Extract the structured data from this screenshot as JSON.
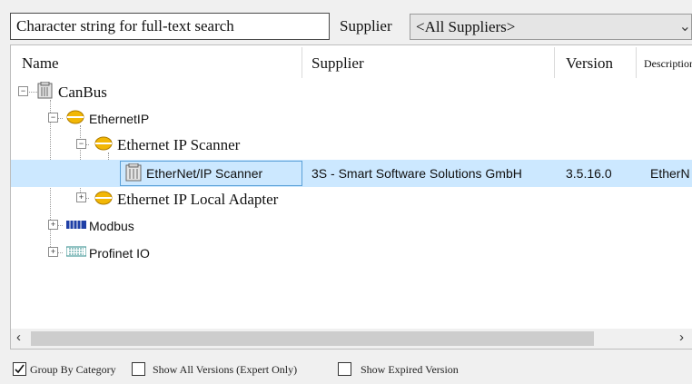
{
  "search": {
    "placeholder": "Character string for full-text search"
  },
  "supplier_filter": {
    "label": "Supplier",
    "selected": "<All Suppliers>"
  },
  "columns": {
    "name": "Name",
    "supplier": "Supplier",
    "version": "Version",
    "description": "Description"
  },
  "tree": {
    "canbus": {
      "label": "CanBus"
    },
    "ethernetip": {
      "label": "EthernetIP"
    },
    "ethernet_ip_scanner": {
      "label": "Ethernet IP Scanner"
    },
    "device": {
      "name": "EtherNet/IP Scanner",
      "supplier": "3S - Smart Software Solutions GmbH",
      "version": "3.5.16.0",
      "description": "EtherN"
    },
    "ethernet_ip_local_adapter": {
      "label": "Ethernet IP Local Adapter"
    },
    "modbus": {
      "label": "Modbus"
    },
    "profinet": {
      "label": "Profinet IO"
    }
  },
  "options": {
    "group_by_category": {
      "label": "Group By Category",
      "checked": true
    },
    "show_all_versions": {
      "label": "Show All Versions (Expert Only)",
      "checked": false
    },
    "show_expired": {
      "label": "Show Expired Version",
      "checked": false
    }
  },
  "colors": {
    "selection": "#cce8ff",
    "selection_border": "#5aa0d8",
    "folder_icon": "#f2b705"
  }
}
